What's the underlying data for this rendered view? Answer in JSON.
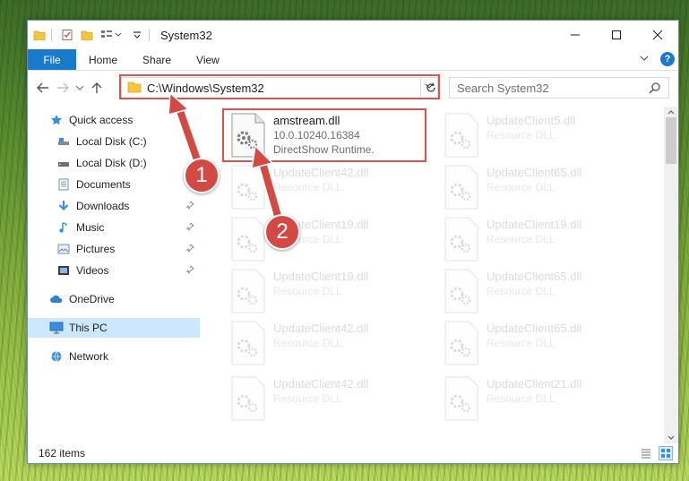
{
  "window": {
    "title": "System32"
  },
  "ribbon": {
    "tabs": [
      {
        "label": "File"
      },
      {
        "label": "Home"
      },
      {
        "label": "Share"
      },
      {
        "label": "View"
      }
    ]
  },
  "address": {
    "path": "C:\\Windows\\System32"
  },
  "search": {
    "placeholder": "Search System32"
  },
  "sidebar": {
    "items": [
      {
        "label": "Quick access",
        "icon": "star-icon"
      },
      {
        "label": "Local Disk (C:)",
        "icon": "drive-icon"
      },
      {
        "label": "Local Disk (D:)",
        "icon": "drive-icon"
      },
      {
        "label": "Documents",
        "icon": "documents-icon"
      },
      {
        "label": "Downloads",
        "icon": "download-icon"
      },
      {
        "label": "Music",
        "icon": "music-icon"
      },
      {
        "label": "Pictures",
        "icon": "pictures-icon"
      },
      {
        "label": "Videos",
        "icon": "videos-icon"
      },
      {
        "label": "OneDrive",
        "icon": "cloud-icon"
      },
      {
        "label": "This PC",
        "icon": "monitor-icon"
      },
      {
        "label": "Network",
        "icon": "network-icon"
      }
    ]
  },
  "files": [
    {
      "name": "amstream.dll",
      "line1": "10.0.10240.16384",
      "line2": "DirectShow Runtime."
    },
    {
      "name": "UpdateClient5.dll",
      "line1": "Resource DLL"
    },
    {
      "name": "UpdateClient42.dll",
      "line1": "Resource DLL"
    },
    {
      "name": "UpdateClient65.dll",
      "line1": "Resource DLL"
    },
    {
      "name": "UpdateClient19.dll",
      "line1": "Resource DLL"
    },
    {
      "name": "UpdateClient19.dll",
      "line1": "Resource DLL"
    },
    {
      "name": "UpdateClient19.dll",
      "line1": "Resource DLL"
    },
    {
      "name": "UpdateClient65.dll",
      "line1": "Resource DLL"
    },
    {
      "name": "UpdateClient42.dll",
      "line1": "Resource DLL"
    },
    {
      "name": "UpdateClient65.dll",
      "line1": "Resource DLL"
    },
    {
      "name": "UpdateClient42.dll",
      "line1": "Resource DLL"
    },
    {
      "name": "UpdateClient21.dll",
      "line1": "Resource DLL"
    }
  ],
  "status": {
    "count": "162 items"
  },
  "annotations": [
    {
      "label": "1"
    },
    {
      "label": "2"
    }
  ],
  "colors": {
    "accent": "#1979ca",
    "highlight": "#d9534f",
    "annotation": "#d24a43",
    "selected": "#cce8ff"
  }
}
